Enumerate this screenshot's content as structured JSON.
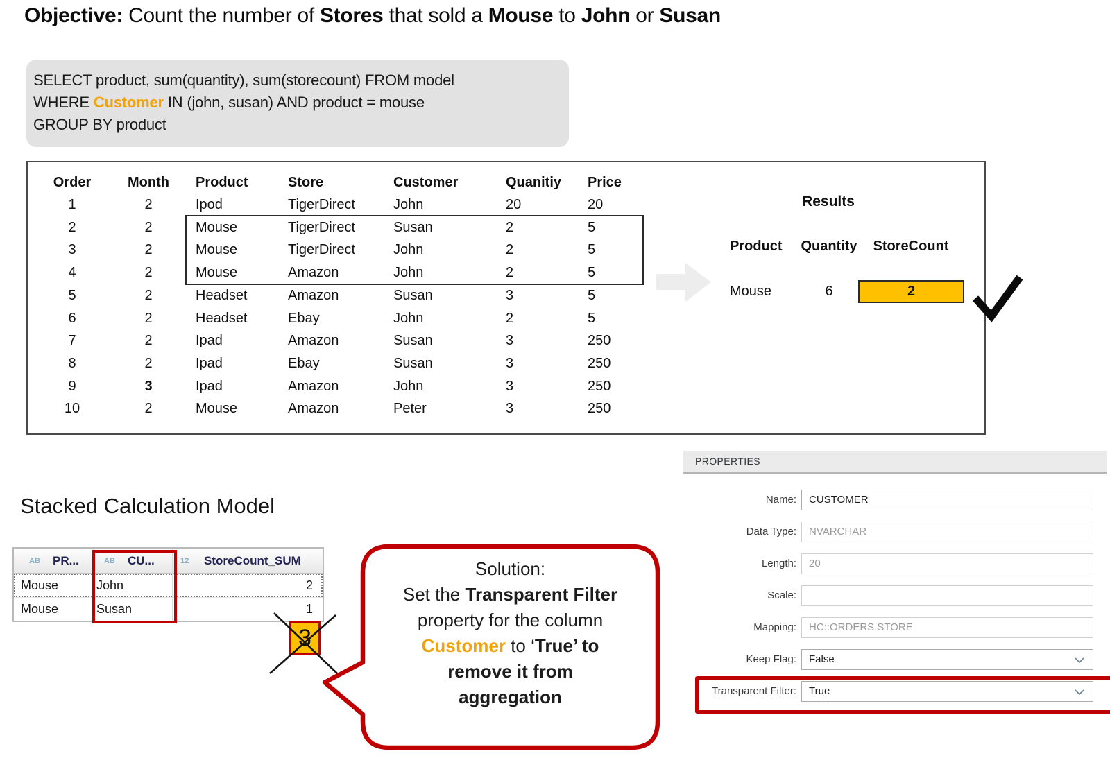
{
  "title": {
    "segments": [
      {
        "text": "Objective:",
        "bold": true
      },
      {
        "text": "  Count the number of ",
        "bold": false
      },
      {
        "text": "Stores",
        "bold": true
      },
      {
        "text": " that sold a ",
        "bold": false
      },
      {
        "text": "Mouse",
        "bold": true
      },
      {
        "text": " to ",
        "bold": false
      },
      {
        "text": "John",
        "bold": true
      },
      {
        "text": " or ",
        "bold": false
      },
      {
        "text": "Susan",
        "bold": true
      }
    ]
  },
  "sql": {
    "line1": "SELECT product, sum(quantity), sum(storecount) FROM model",
    "line2a": "WHERE ",
    "line2b": "Customer",
    "line2c": " IN (john, susan) AND product = mouse",
    "line3": "GROUP BY product"
  },
  "orders_table": {
    "headers": [
      "Order",
      "Month",
      "Product",
      "Store",
      "Customer",
      "Quanitiy",
      "Price"
    ],
    "rows": [
      [
        "1",
        "2",
        "Ipod",
        "TigerDirect",
        "John",
        "20",
        "20"
      ],
      [
        "2",
        "2",
        "Mouse",
        "TigerDirect",
        "Susan",
        "2",
        "5"
      ],
      [
        "3",
        "2",
        "Mouse",
        "TigerDirect",
        "John",
        "2",
        "5"
      ],
      [
        "4",
        "2",
        "Mouse",
        "Amazon",
        "John",
        "2",
        "5"
      ],
      [
        "5",
        "2",
        "Headset",
        "Amazon",
        "Susan",
        "3",
        "5"
      ],
      [
        "6",
        "2",
        "Headset",
        "Ebay",
        "John",
        "2",
        "5"
      ],
      [
        "7",
        "2",
        "Ipad",
        "Amazon",
        "Susan",
        "3",
        "250"
      ],
      [
        "8",
        "2",
        "Ipad",
        "Ebay",
        "Susan",
        "3",
        "250"
      ],
      [
        "9",
        "3",
        "Ipad",
        "Amazon",
        "John",
        "3",
        "250"
      ],
      [
        "10",
        "2",
        "Mouse",
        "Amazon",
        "Peter",
        "3",
        "250"
      ]
    ],
    "bold_month_row_index": 8,
    "highlighted_row_orders": [
      "2",
      "3",
      "4"
    ]
  },
  "results": {
    "title": "Results",
    "headers": [
      "Product",
      "Quantity",
      "StoreCount"
    ],
    "row": {
      "product": "Mouse",
      "quantity": "6",
      "storecount": "2"
    }
  },
  "stacked": {
    "heading": "Stacked Calculation Model",
    "grid": {
      "columns": [
        {
          "type_icon": "AB",
          "label": "PR..."
        },
        {
          "type_icon": "AB",
          "label": "CU..."
        },
        {
          "type_icon": "12",
          "label": "StoreCount_SUM"
        }
      ],
      "rows": [
        [
          "Mouse",
          "John",
          "2"
        ],
        [
          "Mouse",
          "Susan",
          "1"
        ]
      ]
    },
    "crossed_value": "3"
  },
  "callout": {
    "line1": "Solution:",
    "line2a": "Set the ",
    "line2b": "Transparent Filter",
    "line3": "property for the column",
    "line4a": "Customer",
    "line4b": "  to ‘",
    "line4c": "True’ to",
    "line5": "remove it from",
    "line6": "aggregation"
  },
  "properties": {
    "header": "PROPERTIES",
    "fields": [
      {
        "label": "Name:",
        "value": "CUSTOMER",
        "muted": false,
        "dropdown": false,
        "highlight": false
      },
      {
        "label": "Data Type:",
        "value": "NVARCHAR",
        "muted": true,
        "dropdown": false,
        "highlight": false
      },
      {
        "label": "Length:",
        "value": "20",
        "muted": true,
        "dropdown": false,
        "highlight": false
      },
      {
        "label": "Scale:",
        "value": "",
        "muted": true,
        "dropdown": false,
        "highlight": false
      },
      {
        "label": "Mapping:",
        "value": "HC::ORDERS.STORE",
        "muted": true,
        "dropdown": false,
        "highlight": false
      },
      {
        "label": "Keep Flag:",
        "value": "False",
        "muted": false,
        "dropdown": true,
        "highlight": false
      },
      {
        "label": "Transparent Filter:",
        "value": "True",
        "muted": false,
        "dropdown": true,
        "highlight": true
      }
    ]
  },
  "colors": {
    "accent_orange": "#F0A30A",
    "highlight_yellow": "#FFC000",
    "alert_red": "#C00000",
    "arrow_gray": "#EDEDED"
  }
}
